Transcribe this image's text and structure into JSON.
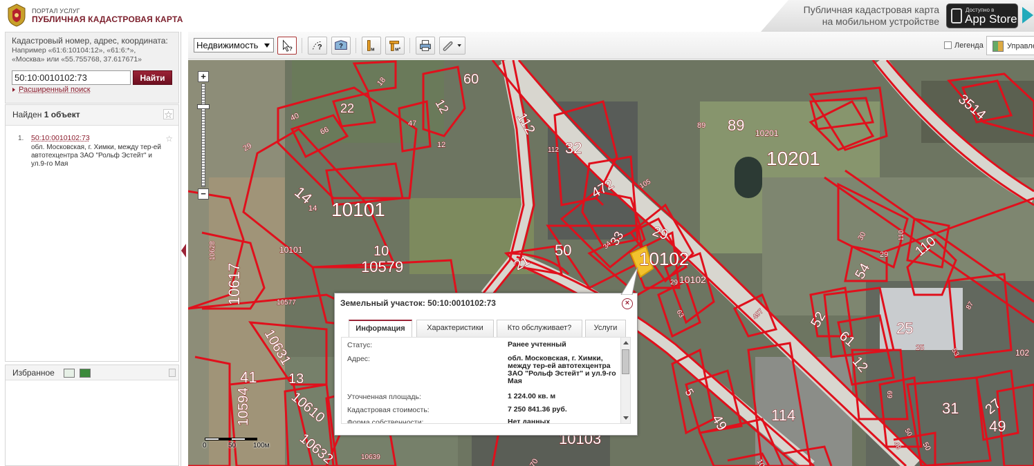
{
  "header": {
    "portal_label": "ПОРТАЛ УСЛУГ",
    "portal_title": "ПУБЛИЧНАЯ КАДАСТРОВАЯ КАРТА",
    "mobile_text_line1": "Публичная кадастровая карта",
    "mobile_text_line2": "на мобильном устройстве",
    "appstore_small": "Доступно в",
    "appstore_big": "App Store"
  },
  "search": {
    "hint_title": "Кадастровый номер, адрес, координата:",
    "hint_examples_line1": "Например «61:6:10104:12», «61:6:*»,",
    "hint_examples_line2": "«Москва» или «55.755768, 37.617671»",
    "input_value": "50:10:0010102:73",
    "button_label": "Найти",
    "advanced_label": "Расширенный поиск"
  },
  "results": {
    "header_prefix": "Найден",
    "header_count": "1 объект",
    "items": [
      {
        "num": "1.",
        "link": "50:10:0010102:73",
        "address": "обл. Московская, г. Химки, между тер-ей автотехцентра ЗАО \"Рольф Эстейт\" и ул.9-го Мая"
      }
    ]
  },
  "favorites": {
    "header": "Избранное"
  },
  "toolbar": {
    "layer_select": "Недвижимость",
    "legend_label": "Легенда",
    "manage_label": "Управление картой",
    "buttons": [
      "select-info-icon",
      "identify-icon",
      "area-info-icon",
      "ruler-icon",
      "area-measure-icon",
      "print-icon",
      "link-icon"
    ]
  },
  "map": {
    "scale_labels": [
      "0",
      "50",
      "100м"
    ],
    "labels": [
      "60",
      "22",
      "12",
      "47",
      "12",
      "40",
      "66",
      "29",
      "14",
      "14",
      "10101",
      "10628",
      "10101",
      "10",
      "10579",
      "10617",
      "10577",
      "10631",
      "41",
      "13",
      "10594",
      "10610",
      "10632",
      "10639",
      "112",
      "32",
      "112",
      "89",
      "89",
      "10201",
      "10201",
      "472",
      "105",
      "21",
      "50",
      "33",
      "34",
      "29",
      "10102",
      "29",
      "10102",
      "497",
      "63",
      "5",
      "49",
      "114",
      "10103",
      "70",
      "10",
      "3514",
      "30",
      "110",
      "110",
      "54",
      "29",
      "52",
      "25",
      "25",
      "61",
      "12",
      "69",
      "87",
      "53",
      "31",
      "27",
      "49",
      "50",
      "48",
      "50",
      "102",
      "18"
    ]
  },
  "popup": {
    "title": "Земельный участок: 50:10:0010102:73",
    "close": "×",
    "tabs": [
      "Информация",
      "Характеристики",
      "Кто обслуживает?",
      "Услуги"
    ],
    "rows": [
      {
        "key": "Статус:",
        "value": "Ранее учтенный"
      },
      {
        "key": "Адрес:",
        "value": "обл. Московская, г. Химки, между тер-ей автотехцентра ЗАО \"Рольф Эстейт\" и ул.9-го Мая"
      },
      {
        "key": "Уточненная площадь:",
        "value": "1 224.00 кв. м"
      },
      {
        "key": "Кадастровая стоимость:",
        "value": "7 250 841.36 руб."
      },
      {
        "key": "Форма собственности:",
        "value": "Нет данных"
      }
    ]
  },
  "colors": {
    "brand": "#7b1e2b",
    "parcel_lines": "#e0101c",
    "selected_parcel": "#f2c12e"
  }
}
